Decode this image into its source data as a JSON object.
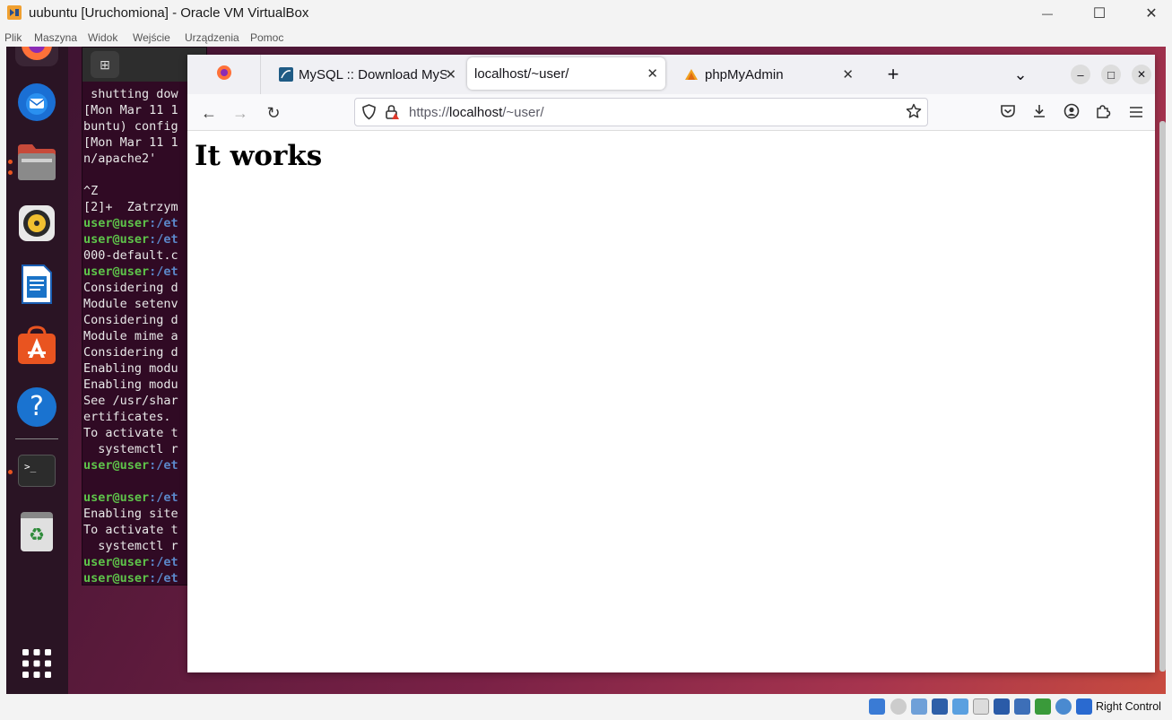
{
  "host_window": {
    "title": "uubuntu [Uruchomiona] - Oracle VM VirtualBox",
    "controls": {
      "minimize": "—",
      "maximize": "☐",
      "close": "✕"
    },
    "menu": [
      "Plik",
      "Maszyna",
      "Widok",
      "Wejście",
      "Urządzenia",
      "Pomoc"
    ],
    "status_host_key": "Right Control"
  },
  "dock": {
    "apps": [
      "firefox-icon",
      "thunderbird-icon",
      "files-icon",
      "rhythmbox-icon",
      "libreoffice-writer-icon",
      "app-center-icon",
      "help-icon",
      "terminal-icon",
      "trash-icon",
      "show-apps-icon"
    ],
    "help_glyph": "?",
    "terminal_glyph": ">_",
    "trash_glyph": "♻"
  },
  "terminal": {
    "new_tab_glyph": "⊞",
    "lines": [
      [
        {
          "t": " shutting dow",
          "c": ""
        }
      ],
      [
        {
          "t": "[Mon Mar 11 1",
          "c": ""
        }
      ],
      [
        {
          "t": "buntu) config",
          "c": ""
        }
      ],
      [
        {
          "t": "[Mon Mar 11 1",
          "c": ""
        }
      ],
      [
        {
          "t": "n/apache2'",
          "c": ""
        }
      ],
      [
        {
          "t": "",
          "c": ""
        }
      ],
      [
        {
          "t": "^Z",
          "c": ""
        }
      ],
      [
        {
          "t": "[2]+  Zatrzym",
          "c": ""
        }
      ],
      [
        {
          "t": "user@user",
          "c": "u"
        },
        {
          "t": ":/et",
          "c": "p"
        }
      ],
      [
        {
          "t": "user@user",
          "c": "u"
        },
        {
          "t": ":/et",
          "c": "p"
        }
      ],
      [
        {
          "t": "000-default.c",
          "c": ""
        }
      ],
      [
        {
          "t": "user@user",
          "c": "u"
        },
        {
          "t": ":/et",
          "c": "p"
        }
      ],
      [
        {
          "t": "Considering d",
          "c": ""
        }
      ],
      [
        {
          "t": "Module setenv",
          "c": ""
        }
      ],
      [
        {
          "t": "Considering d",
          "c": ""
        }
      ],
      [
        {
          "t": "Module mime a",
          "c": ""
        }
      ],
      [
        {
          "t": "Considering d",
          "c": ""
        }
      ],
      [
        {
          "t": "Enabling modu",
          "c": ""
        }
      ],
      [
        {
          "t": "Enabling modu",
          "c": ""
        }
      ],
      [
        {
          "t": "See /usr/shar",
          "c": ""
        }
      ],
      [
        {
          "t": "ertificates.",
          "c": ""
        }
      ],
      [
        {
          "t": "To activate t",
          "c": ""
        }
      ],
      [
        {
          "t": "  systemctl r",
          "c": ""
        }
      ],
      [
        {
          "t": "user@user",
          "c": "u"
        },
        {
          "t": ":/et",
          "c": "p"
        }
      ],
      [
        {
          "t": "",
          "c": ""
        }
      ],
      [
        {
          "t": "user@user",
          "c": "u"
        },
        {
          "t": ":/et",
          "c": "p"
        }
      ],
      [
        {
          "t": "Enabling site",
          "c": ""
        }
      ],
      [
        {
          "t": "To activate t",
          "c": ""
        }
      ],
      [
        {
          "t": "  systemctl r",
          "c": ""
        }
      ],
      [
        {
          "t": "user@user",
          "c": "u"
        },
        {
          "t": ":/et",
          "c": "p"
        }
      ],
      [
        {
          "t": "user@user",
          "c": "u"
        },
        {
          "t": ":/et",
          "c": "p"
        }
      ]
    ]
  },
  "browser": {
    "tabs": [
      {
        "title": "",
        "icon": "firefox-icon"
      },
      {
        "title": "MySQL :: Download MySQL",
        "icon": "mysql-icon"
      },
      {
        "title": "localhost/~user/",
        "icon": ""
      },
      {
        "title": "phpMyAdmin",
        "icon": "phpmyadmin-icon"
      }
    ],
    "tab_close": "✕",
    "new_tab": "+",
    "tab_list": "⌄",
    "window": {
      "minimize": "–",
      "maximize": "□",
      "close": "✕"
    },
    "nav": {
      "back": "←",
      "forward": "→",
      "reload": "↻"
    },
    "url": {
      "scheme": "https://",
      "host": "localhost",
      "path": "/~user/"
    },
    "toolbar_icons": [
      "pocket-icon",
      "downloads-icon",
      "account-icon",
      "extensions-icon",
      "menu-icon"
    ],
    "page": {
      "heading": "It works"
    }
  }
}
